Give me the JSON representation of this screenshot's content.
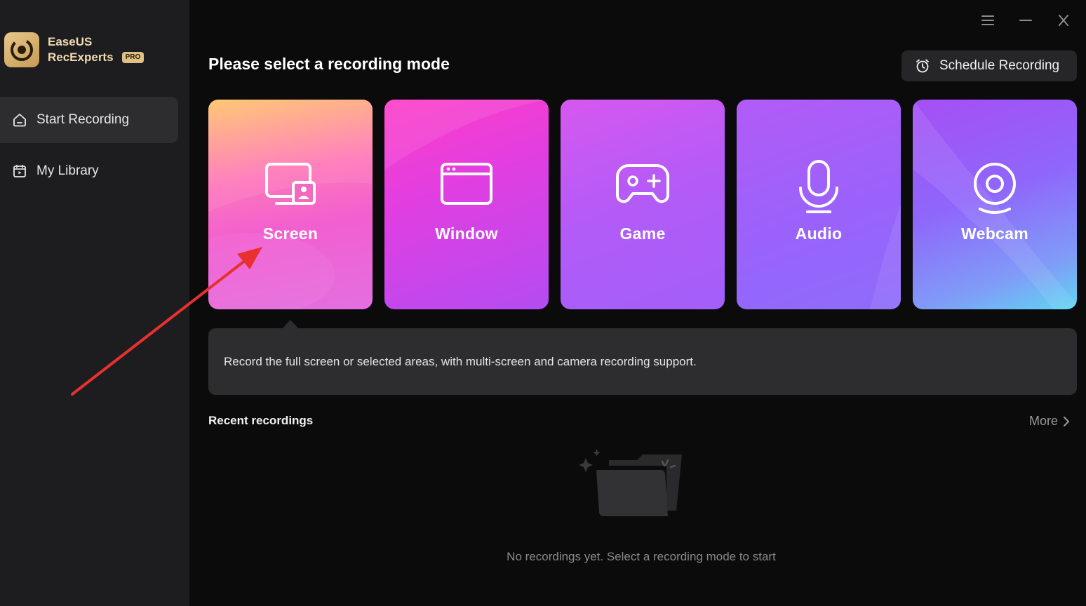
{
  "brand": {
    "line1": "EaseUS",
    "line2": "RecExperts",
    "badge": "PRO",
    "icon": "brand-logo-icon",
    "accent_color": "#d8b477"
  },
  "sidebar": {
    "items": [
      {
        "label": "Start Recording",
        "icon": "home-icon",
        "active": true
      },
      {
        "label": "My Library",
        "icon": "library-icon",
        "active": false
      }
    ]
  },
  "window_controls": {
    "icons": [
      "menu-icon",
      "minimize-icon",
      "close-icon"
    ]
  },
  "main": {
    "title": "Please select a recording mode",
    "schedule_button": {
      "label": "Schedule Recording",
      "icon": "alarm-clock-icon"
    },
    "modes": [
      {
        "label": "Screen",
        "icon": "screen-icon",
        "selected": true
      },
      {
        "label": "Window",
        "icon": "window-icon",
        "selected": false
      },
      {
        "label": "Game",
        "icon": "gamepad-icon",
        "selected": false
      },
      {
        "label": "Audio",
        "icon": "microphone-icon",
        "selected": false
      },
      {
        "label": "Webcam",
        "icon": "webcam-icon",
        "selected": false
      }
    ],
    "description": "Record the full screen or selected areas, with multi-screen and camera recording support.",
    "recent": {
      "title": "Recent recordings",
      "more_label": "More",
      "empty_text": "No recordings yet. Select a recording mode to start",
      "empty_icon": "empty-folder-icon"
    }
  },
  "annotation": {
    "arrow_color": "#e8302e"
  }
}
